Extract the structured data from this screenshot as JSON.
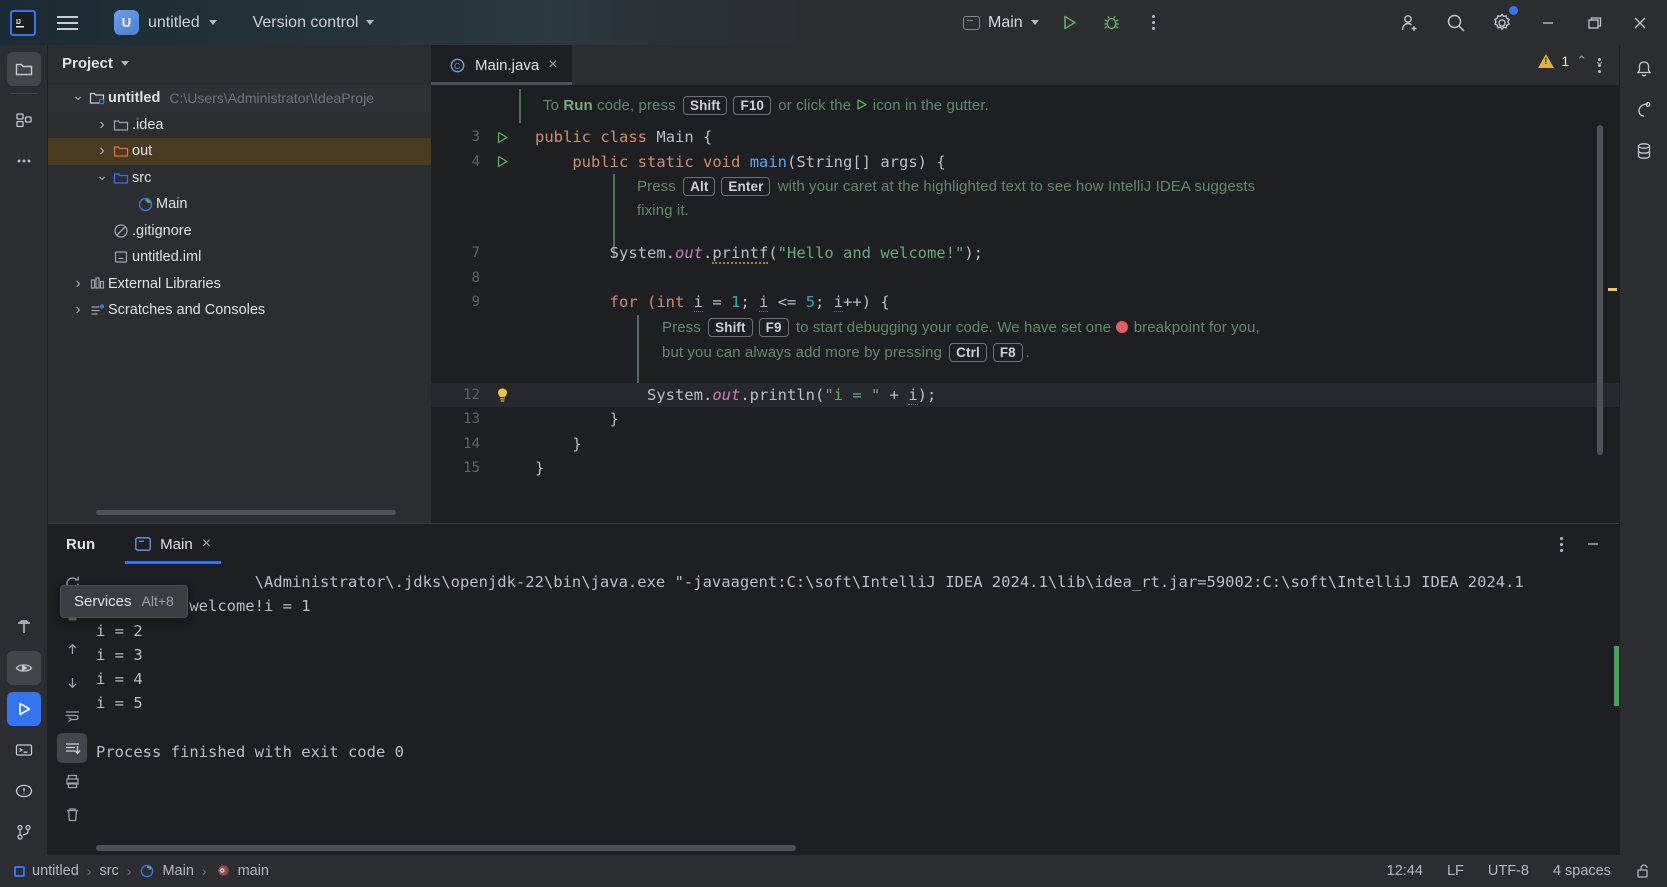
{
  "titlebar": {
    "logo": "IJ",
    "menu_icon": "hamburger-menu-icon",
    "project_badge": "U",
    "project_name": "untitled",
    "vcs_label": "Version control",
    "run_config": "Main",
    "run_icon": "run-icon",
    "debug_icon": "debug-icon",
    "more_icon": "more-vertical-icon",
    "account_icon": "add-account-icon",
    "search_icon": "search-icon",
    "settings_icon": "gear-icon",
    "minimize": "minimize-icon",
    "maximize": "maximize-icon",
    "close": "close-icon"
  },
  "left_stripe": {
    "items": [
      {
        "name": "project-icon",
        "active": true
      },
      {
        "name": "commit-icon",
        "active": false
      },
      {
        "name": "more-tool-windows-icon",
        "active": false
      }
    ],
    "bottom_items": [
      {
        "name": "build-hammer-icon",
        "active": false
      },
      {
        "name": "debug-eye-icon",
        "active": true
      },
      {
        "name": "run-icon",
        "active": true
      },
      {
        "name": "terminal-icon",
        "active": false
      },
      {
        "name": "problems-icon",
        "active": false
      },
      {
        "name": "version-control-icon",
        "active": false
      }
    ]
  },
  "right_stripe": {
    "items": [
      {
        "name": "notifications-bell-icon"
      },
      {
        "name": "ai-assistant-icon"
      },
      {
        "name": "database-icon"
      }
    ]
  },
  "project_panel": {
    "title": "Project",
    "tree": [
      {
        "depth": 0,
        "arrow": "down",
        "icon": "module-folder-icon",
        "label": "untitled",
        "bold": true,
        "path": "C:\\Users\\Administrator\\IdeaProje",
        "state": "selected"
      },
      {
        "depth": 1,
        "arrow": "right",
        "icon": "folder-icon",
        "label": ".idea",
        "bold": false,
        "path": "",
        "state": ""
      },
      {
        "depth": 1,
        "arrow": "right",
        "icon": "folder-out-icon",
        "label": "out",
        "bold": false,
        "path": "",
        "state": "highlighted"
      },
      {
        "depth": 1,
        "arrow": "down",
        "icon": "folder-src-icon",
        "label": "src",
        "bold": false,
        "path": "",
        "state": ""
      },
      {
        "depth": 2,
        "arrow": "none",
        "icon": "java-class-icon",
        "label": "Main",
        "bold": false,
        "path": "",
        "state": ""
      },
      {
        "depth": 1,
        "arrow": "none",
        "icon": "gitignore-icon",
        "label": ".gitignore",
        "bold": false,
        "path": "",
        "state": ""
      },
      {
        "depth": 1,
        "arrow": "none",
        "icon": "iml-file-icon",
        "label": "untitled.iml",
        "bold": false,
        "path": "",
        "state": ""
      },
      {
        "depth": 0,
        "arrow": "right",
        "icon": "libraries-icon",
        "label": "External Libraries",
        "bold": false,
        "path": "",
        "state": ""
      },
      {
        "depth": 0,
        "arrow": "right",
        "icon": "scratches-icon",
        "label": "Scratches and Consoles",
        "bold": false,
        "path": "",
        "state": ""
      }
    ]
  },
  "editor": {
    "tab": {
      "label": "Main.java",
      "icon": "java-class-icon",
      "close": "×"
    },
    "more_icon": "more-vertical-icon",
    "inspection": {
      "warning_count": "1",
      "up": "⌃",
      "down": "⌄"
    },
    "banners": {
      "run_hint": {
        "pre": "To ",
        "bold": "Run",
        "mid": " code, press ",
        "k1": "Shift",
        "k2": "F10",
        "post": " or click the",
        "tail": "icon in the gutter."
      },
      "altenter_hint": {
        "pre": "Press ",
        "k1": "Alt",
        "k2": "Enter",
        "post": " with your caret at the highlighted text to see how IntelliJ IDEA suggests",
        "line2": "fixing it."
      },
      "debug_hint": {
        "pre": "Press ",
        "k1": "Shift",
        "k2": "F9",
        "mid": " to start debugging your code. We have set one",
        "mid2": "breakpoint for you,",
        "line2_pre": "but you can always add more by pressing ",
        "k3": "Ctrl",
        "k4": "F8",
        "line2_post": "."
      }
    },
    "lines": [
      {
        "num": "3",
        "gutter": "run-gutter-icon",
        "highlight": false
      },
      {
        "num": "4",
        "gutter": "run-gutter-icon",
        "highlight": false
      },
      {
        "num": "7",
        "gutter": "",
        "highlight": false
      },
      {
        "num": "8",
        "gutter": "",
        "highlight": false
      },
      {
        "num": "9",
        "gutter": "",
        "highlight": false
      },
      {
        "num": "12",
        "gutter": "lightbulb-icon",
        "highlight": true
      },
      {
        "num": "13",
        "gutter": "",
        "highlight": false
      },
      {
        "num": "14",
        "gutter": "",
        "highlight": false
      },
      {
        "num": "15",
        "gutter": "",
        "highlight": false
      }
    ],
    "code": {
      "l3_public": "public",
      "l3_class": "class",
      "l3_name": "Main",
      "l3_brace": "{",
      "l4_public": "public",
      "l4_static": "static",
      "l4_void": "void",
      "l4_main": "main",
      "l4_params": "(String[] args) {",
      "l7_system": "System.",
      "l7_out": "out",
      "l7_dot": ".",
      "l7_printf": "printf",
      "l7_open": "(",
      "l7_str": "\"Hello and welcome!\"",
      "l7_close": ");",
      "l9_for": "for",
      "l9_a": " (int ",
      "l9_i1": "i",
      "l9_b": " = ",
      "l9_n1": "1",
      "l9_c": "; ",
      "l9_i2": "i",
      "l9_d": " <= ",
      "l9_n2": "5",
      "l9_e": "; ",
      "l9_i3": "i",
      "l9_f": "++) {",
      "l12_system": "System.",
      "l12_out": "out",
      "l12_dot": ".",
      "l12_println": "println",
      "l12_open": "(",
      "l12_str": "\"i = \"",
      "l12_plus": " + ",
      "l12_i": "i",
      "l12_close": ");",
      "l13_brace": "}",
      "l14_brace": "}",
      "l15_brace": "}"
    }
  },
  "run_panel": {
    "label": "Run",
    "tab": {
      "label": "Main",
      "icon": "run-config-icon",
      "close": "×"
    },
    "more_icon": "more-vertical-icon",
    "minimize_icon": "minimize-icon",
    "toolbar": [
      {
        "name": "rerun-icon"
      },
      {
        "name": "stop-icon"
      },
      {
        "name": "up-arrow-icon"
      },
      {
        "name": "down-arrow-icon"
      },
      {
        "name": "soft-wrap-icon"
      },
      {
        "name": "scroll-to-end-icon",
        "active": true
      },
      {
        "name": "print-icon"
      },
      {
        "name": "clear-all-icon"
      }
    ],
    "console": [
      "                 \\Administrator\\.jdks\\openjdk-22\\bin\\java.exe \"-javaagent:C:\\soft\\IntelliJ IDEA 2024.1\\lib\\idea_rt.jar=59002:C:\\soft\\IntelliJ IDEA 2024.1",
      "Hello and welcome!i = 1",
      "i = 2",
      "i = 3",
      "i = 4",
      "i = 5",
      "",
      "Process finished with exit code 0"
    ]
  },
  "tooltip": {
    "label": "Services",
    "shortcut": "Alt+8"
  },
  "statusbar": {
    "breadcrumbs": [
      {
        "icon": "module-icon",
        "label": "untitled"
      },
      {
        "icon": "",
        "label": "src"
      },
      {
        "icon": "java-class-icon",
        "label": "Main"
      },
      {
        "icon": "method-icon",
        "label": "main"
      }
    ],
    "separator": "›",
    "time": "12:44",
    "line_separator": "LF",
    "encoding": "UTF-8",
    "indent": "4 spaces",
    "lock_icon": "unlocked-icon"
  },
  "colors": {
    "accent": "#3574f0",
    "bg": "#1e1f22",
    "panel": "#2b2d30",
    "green": "#5fad65",
    "warning": "#e0b040",
    "highlight_row": "#4a3a22"
  }
}
